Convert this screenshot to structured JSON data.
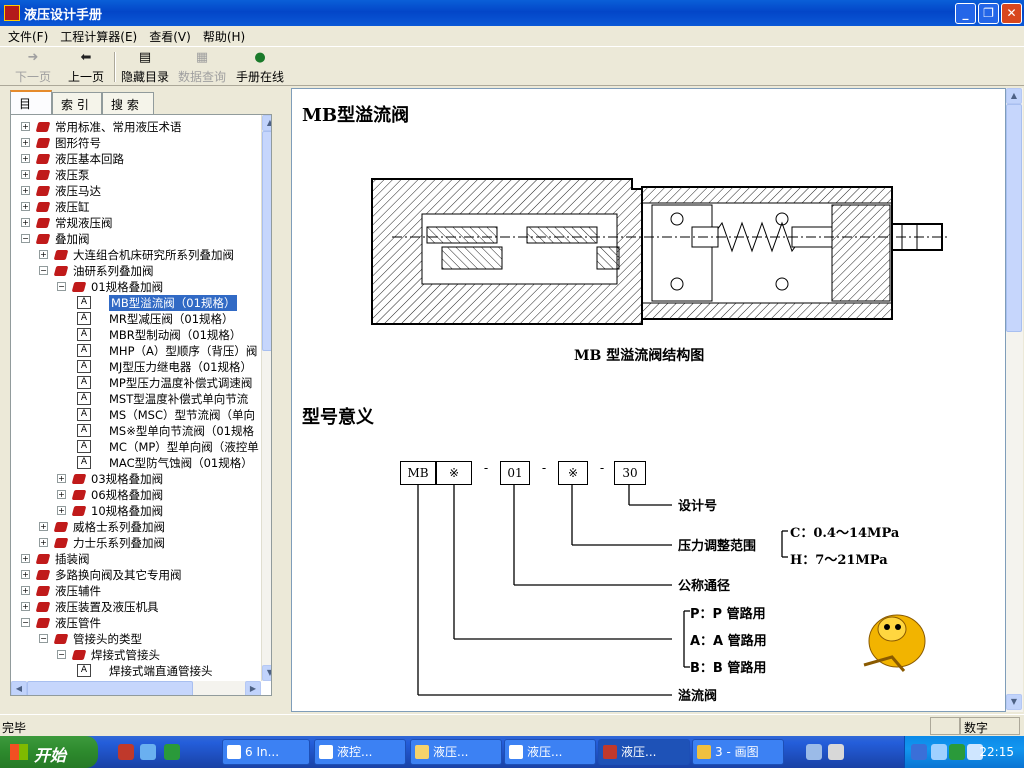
{
  "window": {
    "title": "液压设计手册"
  },
  "menu": [
    "文件(F)",
    "工程计算器(E)",
    "查看(V)",
    "帮助(H)"
  ],
  "toolbar": {
    "back": "下一页",
    "forward": "上一页",
    "hide_toc": "隐藏目录",
    "data_query": "数据查询",
    "online": "手册在线"
  },
  "tabs": [
    "目 录",
    "索 引",
    "搜 索"
  ],
  "tree": [
    {
      "label": "常用标准、常用液压术语",
      "level": 0,
      "kind": "book",
      "expanded": false
    },
    {
      "label": "图形符号",
      "level": 0,
      "kind": "book",
      "expanded": false
    },
    {
      "label": "液压基本回路",
      "level": 0,
      "kind": "book",
      "expanded": false
    },
    {
      "label": "液压泵",
      "level": 0,
      "kind": "book",
      "expanded": false
    },
    {
      "label": "液压马达",
      "level": 0,
      "kind": "book",
      "expanded": false
    },
    {
      "label": "液压缸",
      "level": 0,
      "kind": "book",
      "expanded": false
    },
    {
      "label": "常规液压阀",
      "level": 0,
      "kind": "book",
      "expanded": false
    },
    {
      "label": "叠加阀",
      "level": 0,
      "kind": "book",
      "expanded": true
    },
    {
      "label": "大连组合机床研究所系列叠加阀",
      "level": 1,
      "kind": "book",
      "expanded": false
    },
    {
      "label": "油研系列叠加阀",
      "level": 1,
      "kind": "book",
      "expanded": true
    },
    {
      "label": "01规格叠加阀",
      "level": 2,
      "kind": "book",
      "expanded": true
    },
    {
      "label": "MB型溢流阀（01规格）",
      "level": 3,
      "kind": "doc",
      "selected": true
    },
    {
      "label": "MR型减压阀（01规格）",
      "level": 3,
      "kind": "doc"
    },
    {
      "label": "MBR型制动阀（01规格）",
      "level": 3,
      "kind": "doc"
    },
    {
      "label": "MHP（A）型顺序（背压）阀",
      "level": 3,
      "kind": "doc"
    },
    {
      "label": "MJ型压力继电器（01规格）",
      "level": 3,
      "kind": "doc"
    },
    {
      "label": "MP型压力温度补偿式调速阀",
      "level": 3,
      "kind": "doc"
    },
    {
      "label": "MST型温度补偿式单向节流",
      "level": 3,
      "kind": "doc"
    },
    {
      "label": "MS（MSC）型节流阀（单向",
      "level": 3,
      "kind": "doc"
    },
    {
      "label": "MS※型单向节流阀（01规格",
      "level": 3,
      "kind": "doc"
    },
    {
      "label": "MC（MP）型单向阀（液控单",
      "level": 3,
      "kind": "doc"
    },
    {
      "label": "MAC型防气蚀阀（01规格）",
      "level": 3,
      "kind": "doc"
    },
    {
      "label": "03规格叠加阀",
      "level": 2,
      "kind": "book",
      "expanded": false
    },
    {
      "label": "06规格叠加阀",
      "level": 2,
      "kind": "book",
      "expanded": false
    },
    {
      "label": "10规格叠加阀",
      "level": 2,
      "kind": "book",
      "expanded": false
    },
    {
      "label": "威格士系列叠加阀",
      "level": 1,
      "kind": "book",
      "expanded": false
    },
    {
      "label": "力士乐系列叠加阀",
      "level": 1,
      "kind": "book",
      "expanded": false
    },
    {
      "label": "插装阀",
      "level": 0,
      "kind": "book",
      "expanded": false
    },
    {
      "label": "多路换向阀及其它专用阀",
      "level": 0,
      "kind": "book",
      "expanded": false
    },
    {
      "label": "液压辅件",
      "level": 0,
      "kind": "book",
      "expanded": false
    },
    {
      "label": "液压装置及液压机具",
      "level": 0,
      "kind": "book",
      "expanded": false
    },
    {
      "label": "液压管件",
      "level": 0,
      "kind": "book",
      "expanded": true
    },
    {
      "label": "管接头的类型",
      "level": 1,
      "kind": "book",
      "expanded": true
    },
    {
      "label": "焊接式管接头",
      "level": 2,
      "kind": "book",
      "expanded": true
    },
    {
      "label": "焊接式端直通管接头",
      "level": 3,
      "kind": "doc"
    }
  ],
  "content": {
    "heading": "MB型溢流阀",
    "figure_caption": "MB 型溢流阀结构图",
    "section_heading": "型号意义",
    "code_boxes": [
      "MB",
      "※",
      "01",
      "※",
      "30"
    ],
    "code_dash": "-",
    "meanings": {
      "design": "设计号",
      "pressure": "压力调整范围",
      "pressure_c": "C：0.4～14MPa",
      "pressure_h": "H：7～21MPa",
      "diameter": "公称通径",
      "p_line": "P：P 管路用",
      "a_line": "A：A 管路用",
      "b_line": "B：B 管路用",
      "relief": "溢流阀"
    }
  },
  "status": {
    "text": "完毕",
    "num": "数字"
  },
  "taskbar": {
    "start": "开始",
    "tasks": [
      "6 In...",
      "液控...",
      "液压...",
      "液压...",
      "液压...",
      "3 - 画图"
    ],
    "clock": "22:15"
  }
}
